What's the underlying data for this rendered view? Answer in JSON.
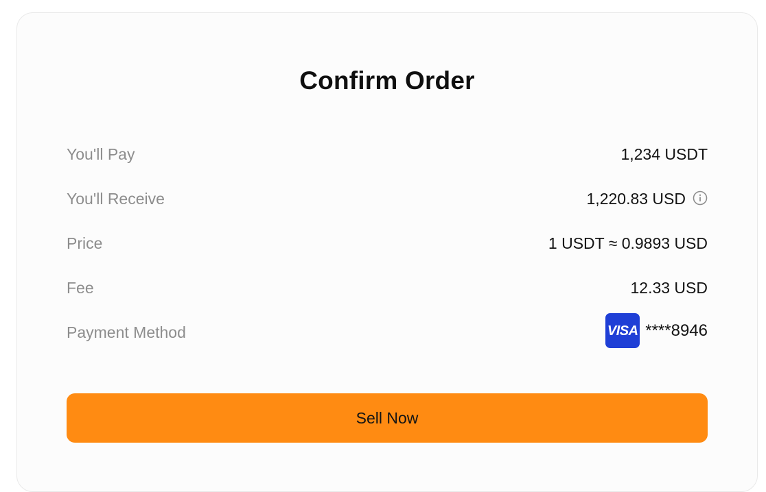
{
  "dialog": {
    "title": "Confirm Order"
  },
  "order": {
    "rows": [
      {
        "label": "You'll Pay",
        "value": "1,234 USDT"
      },
      {
        "label": "You'll Receive",
        "value": "1,220.83 USD",
        "icon": "info-icon"
      },
      {
        "label": "Price",
        "value": "1 USDT ≈ 0.9893 USD"
      },
      {
        "label": "Fee",
        "value": "12.33 USD"
      }
    ],
    "payment": {
      "label": "Payment Method",
      "card_brand": "VISA",
      "card_masked": "****8946"
    }
  },
  "actions": {
    "sell_label": "Sell Now"
  },
  "colors": {
    "accent": "#FF8B12",
    "visa": "#1F3FD6",
    "label": "#8D8D8D",
    "text": "#141414"
  }
}
